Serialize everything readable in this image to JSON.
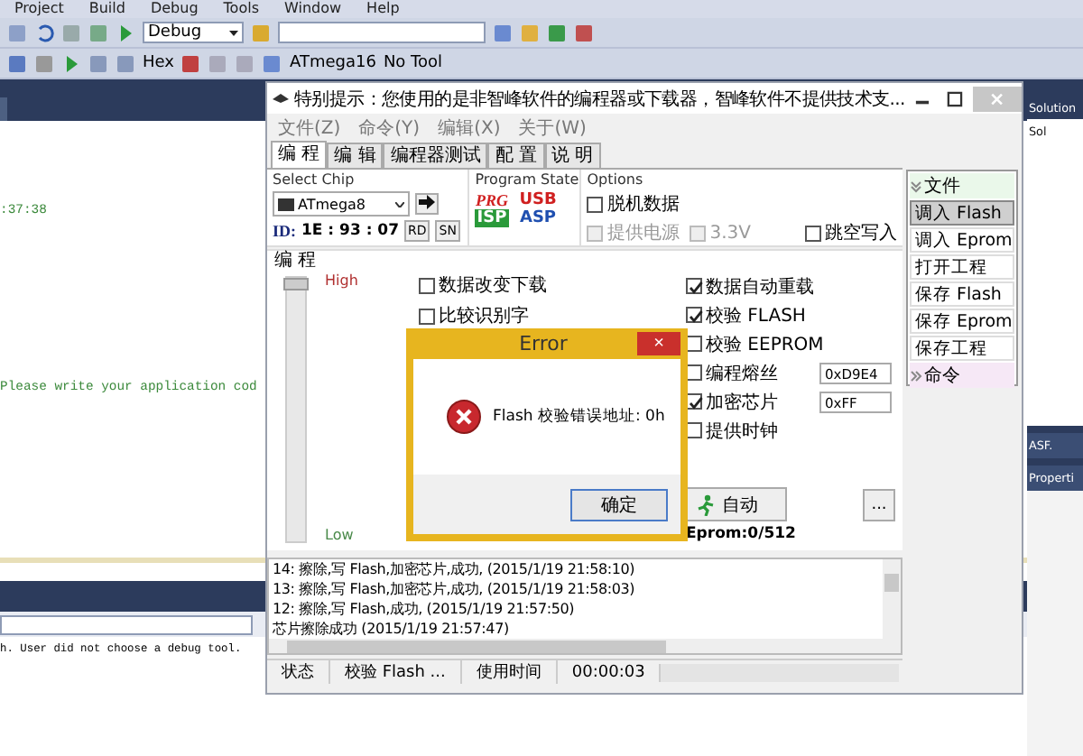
{
  "ide": {
    "menu": [
      "Project",
      "Build",
      "Debug",
      "Tools",
      "Window",
      "Help"
    ],
    "toolbar": {
      "configuration": "Debug",
      "hex": "Hex",
      "device": "ATmega16",
      "tool": "No Tool"
    },
    "editor_lines": [
      ":37:38",
      "Please write your application cod"
    ],
    "output_line": "h. User did not choose a debug tool.",
    "solution_panel": {
      "title": "Solution",
      "root": "Sol",
      "asf": "ASF.",
      "properties": "Properti"
    }
  },
  "programmer": {
    "title": "特别提示：您使用的是非智峰软件的编程器或下载器，智峰软件不提供技术支...",
    "menu": [
      "文件(Z)",
      "命令(Y)",
      "编辑(X)",
      "关于(W)"
    ],
    "tabs": [
      {
        "label": "编 程",
        "selected": true
      },
      {
        "label": "编 辑",
        "selected": false
      },
      {
        "label": "编程器测试",
        "selected": false
      },
      {
        "label": "配 置",
        "selected": false
      },
      {
        "label": "说 明",
        "selected": false
      }
    ],
    "select_chip": {
      "label": "Select Chip",
      "chip": "ATmega8",
      "id_label": "ID:",
      "id": "1E : 93 : 07",
      "buttons": [
        "RD",
        "SN"
      ]
    },
    "program_state": {
      "label": "Program State",
      "logos": [
        "PRG",
        "ISP",
        "USB",
        "ASP"
      ]
    },
    "options": {
      "label": "Options",
      "items": [
        {
          "label": "脱机数据",
          "checked": false,
          "disabled": false
        },
        {
          "label": "提供电源",
          "checked": false,
          "disabled": true
        },
        {
          "label": "3.3V",
          "checked": false,
          "disabled": true
        },
        {
          "label": "跳空写入",
          "checked": false,
          "disabled": false
        }
      ]
    },
    "program_section": {
      "label": "编 程",
      "slider": {
        "high": "High",
        "low": "Low",
        "level": 1
      },
      "left_checks": [
        {
          "label": "数据改变下载",
          "checked": false
        },
        {
          "label": "比较识别字",
          "checked": false
        }
      ],
      "right_checks": [
        {
          "label": "数据自动重载",
          "checked": true
        },
        {
          "label": "校验 FLASH",
          "checked": true
        },
        {
          "label": "校验 EEPROM",
          "checked": false
        },
        {
          "label": "编程熔丝",
          "checked": false,
          "value": "0xD9E4"
        },
        {
          "label": "加密芯片",
          "checked": true,
          "value": "0xFF"
        },
        {
          "label": "提供时钟",
          "checked": false
        }
      ],
      "auto_button": "自动",
      "more_button": "...",
      "eprom": "Eprom:0/512"
    },
    "side_panel": [
      {
        "kind": "header",
        "label": "文件"
      },
      {
        "kind": "button",
        "label": "调入 Flash",
        "selected": true
      },
      {
        "kind": "button",
        "label": "调入 Eprom",
        "selected": false
      },
      {
        "kind": "button",
        "label": "打开工程",
        "selected": false
      },
      {
        "kind": "button",
        "label": "保存 Flash",
        "selected": false
      },
      {
        "kind": "button",
        "label": "保存 Eprom",
        "selected": false
      },
      {
        "kind": "button",
        "label": "保存工程",
        "selected": false
      },
      {
        "kind": "header",
        "label": "命令"
      }
    ],
    "log": [
      "14: 擦除,写 Flash,加密芯片,成功, (2015/1/19 21:58:10)",
      "13: 擦除,写 Flash,加密芯片,成功, (2015/1/19 21:58:03)",
      "12: 擦除,写 Flash,成功, (2015/1/19 21:57:50)",
      "芯片擦除成功 (2015/1/19 21:57:47)"
    ],
    "status_bar": [
      "状态",
      "校验 Flash ...",
      "使用时间",
      "00:00:03"
    ]
  },
  "error_dialog": {
    "title": "Error",
    "close": "×",
    "message": "Flash 校验错误地址: 0h",
    "button": "确定"
  }
}
